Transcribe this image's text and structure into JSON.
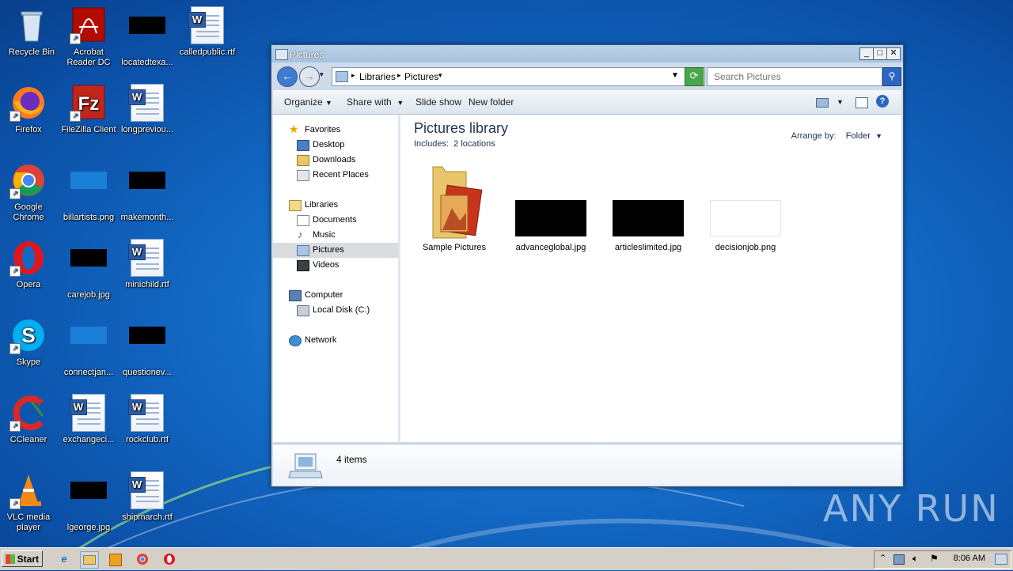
{
  "desktop": {
    "icons": [
      {
        "label": "Recycle Bin"
      },
      {
        "label": "Acrobat Reader DC"
      },
      {
        "label": "locatedtexa..."
      },
      {
        "label": "calledpublic.rtf"
      },
      {
        "label": "Firefox"
      },
      {
        "label": "FileZilla Client"
      },
      {
        "label": "longpreviou..."
      },
      {
        "label": "Google Chrome"
      },
      {
        "label": "billartists.png"
      },
      {
        "label": "makemonth..."
      },
      {
        "label": "Opera"
      },
      {
        "label": "carejob.jpg"
      },
      {
        "label": "minichild.rtf"
      },
      {
        "label": "Skype"
      },
      {
        "label": "connectjan..."
      },
      {
        "label": "questionev..."
      },
      {
        "label": "CCleaner"
      },
      {
        "label": "exchangeci..."
      },
      {
        "label": "rockclub.rtf"
      },
      {
        "label": "VLC media player"
      },
      {
        "label": "lgeorge.jpg"
      },
      {
        "label": "shipmarch.rtf"
      }
    ]
  },
  "window": {
    "title": "Pictures",
    "buttons": {
      "minimize": "_",
      "maximize": "□",
      "close": "✕"
    },
    "breadcrumb": [
      "Libraries",
      "Pictures"
    ],
    "search_placeholder": "Search Pictures",
    "toolbar": {
      "organize": "Organize",
      "share_with": "Share with",
      "slide_show": "Slide show",
      "new_folder": "New folder"
    },
    "nav": {
      "favorites": "Favorites",
      "desktop": "Desktop",
      "downloads": "Downloads",
      "recent_places": "Recent Places",
      "libraries": "Libraries",
      "documents": "Documents",
      "music": "Music",
      "pictures": "Pictures",
      "videos": "Videos",
      "computer": "Computer",
      "local_disk": "Local Disk (C:)",
      "network": "Network"
    },
    "library": {
      "title": "Pictures library",
      "includes_label": "Includes:",
      "includes_link": "2 locations",
      "arrange_label": "Arrange by:",
      "arrange_value": "Folder"
    },
    "files": [
      {
        "name": "Sample Pictures"
      },
      {
        "name": "advanceglobal.jpg"
      },
      {
        "name": "articleslimited.jpg"
      },
      {
        "name": "decisionjob.png"
      }
    ],
    "status": "4 items"
  },
  "taskbar": {
    "start": "Start",
    "time": "8:06 AM"
  },
  "watermark": "ANY RUN",
  "colors": {
    "accent": "#1268c3",
    "window_frame": "#cfdbe8",
    "selection": "#d9dde2"
  }
}
